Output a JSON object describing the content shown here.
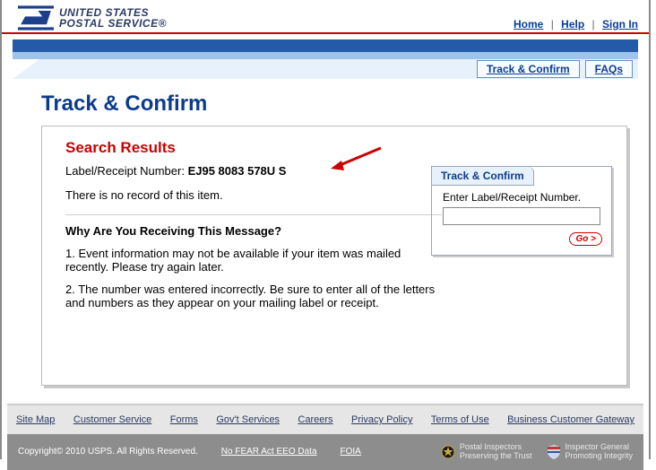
{
  "brand": {
    "line1": "UNITED STATES",
    "line2": "POSTAL SERVICE®"
  },
  "top_nav": {
    "home": "Home",
    "help": "Help",
    "sign_in": "Sign In"
  },
  "tabs": {
    "track": "Track & Confirm",
    "faqs": "FAQs"
  },
  "page_title": "Track & Confirm",
  "results": {
    "heading": "Search Results",
    "label_prefix": "Label/Receipt Number: ",
    "label_number": "EJ95 8083 578U S",
    "no_record": "There is no record of this item.",
    "why_heading": "Why Are You Receiving This Message?",
    "reason1": "1. Event information may not be available if your item was mailed recently. Please try again later.",
    "reason2": "2. The number was entered incorrectly. Be sure to enter all of the letters and numbers as they appear on your mailing label or receipt."
  },
  "sidebox": {
    "title": "Track & Confirm",
    "prompt": "Enter Label/Receipt Number.",
    "go": "Go >"
  },
  "footer": {
    "links": {
      "sitemap": "Site Map",
      "customer": "Customer Service",
      "forms": "Forms",
      "gov": "Gov't Services",
      "careers": "Careers",
      "privacy": "Privacy Policy",
      "terms": "Terms of Use",
      "bcg": "Business Customer Gateway"
    },
    "copyright": "Copyright© 2010 USPS. All Rights Reserved.",
    "nofear": "No FEAR Act EEO Data",
    "foia": "FOIA",
    "badge1a": "Postal Inspectors",
    "badge1b": "Preserving the Trust",
    "badge2a": "Inspector General",
    "badge2b": "Promoting Integrity"
  }
}
